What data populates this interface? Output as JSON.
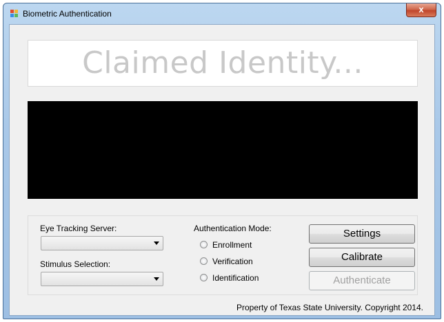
{
  "window": {
    "title": "Biometric Authentication",
    "close_label": "x"
  },
  "identity": {
    "placeholder": "Claimed Identity..."
  },
  "panel": {
    "eye_tracking_label": "Eye Tracking Server:",
    "eye_tracking_value": "",
    "stimulus_label": "Stimulus Selection:",
    "stimulus_value": "",
    "mode_label": "Authentication Mode:",
    "modes": [
      "Enrollment",
      "Verification",
      "Identification"
    ],
    "buttons": {
      "settings": "Settings",
      "calibrate": "Calibrate",
      "authenticate": "Authenticate"
    }
  },
  "footer": {
    "copyright": "Property of Texas State University. Copyright 2014."
  },
  "colors": {
    "title_bar": "#a9c8e8",
    "close_button": "#c0452b",
    "stimulus_display": "#000000",
    "placeholder_text": "#c8c8c8",
    "disabled_text": "#a0a0a0"
  }
}
